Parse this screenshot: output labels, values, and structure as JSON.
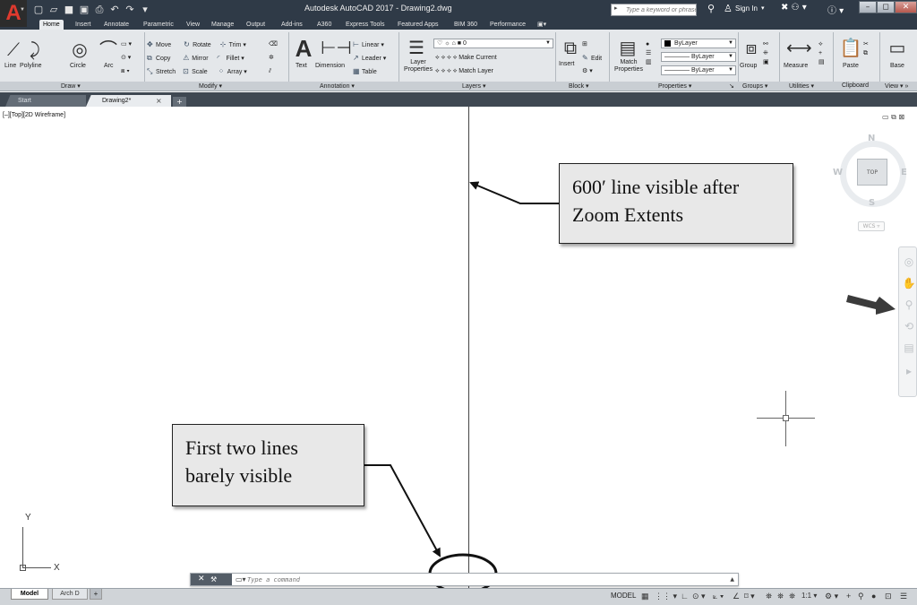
{
  "title_bar": {
    "window_title": "Autodesk AutoCAD 2017 - Drawing2.dwg",
    "app_logo": "A",
    "qat_icons": [
      "new-icon",
      "open-icon",
      "save-icon",
      "saveas-icon",
      "plot-icon",
      "undo-icon",
      "redo-icon",
      "customize-icon"
    ],
    "qat_glyphs": [
      "▢",
      "▱",
      "■",
      "▣",
      "⎙",
      "↶",
      "↷",
      "▾"
    ],
    "search_placeholder": "Type a keyword or phrase",
    "sign_in": "Sign In"
  },
  "ribbon_tabs": [
    "Home",
    "Insert",
    "Annotate",
    "Parametric",
    "View",
    "Manage",
    "Output",
    "Add-ins",
    "A360",
    "Express Tools",
    "Featured Apps",
    "BIM 360",
    "Performance"
  ],
  "ribbon": {
    "draw": {
      "title": "Draw ▾",
      "tools": [
        "Line",
        "Polyline",
        "Circle",
        "Arc"
      ]
    },
    "modify": {
      "title": "Modify ▾",
      "rows": [
        [
          "Move",
          "Rotate",
          "Trim ▾"
        ],
        [
          "Copy",
          "Mirror",
          "Fillet ▾"
        ],
        [
          "Stretch",
          "Scale",
          "Array ▾"
        ]
      ]
    },
    "annotation": {
      "title": "Annotation ▾",
      "big": [
        "Text",
        "Dimension"
      ],
      "small": [
        "Linear ▾",
        "Leader ▾",
        "Table"
      ]
    },
    "layers": {
      "title": "Layers ▾",
      "big": "Layer Properties",
      "current_layer": "0",
      "small": [
        "Make Current",
        "Match Layer"
      ]
    },
    "block": {
      "title": "Block ▾",
      "big": "Insert",
      "small": "Edit"
    },
    "properties": {
      "title": "Properties ▾",
      "big": "Match Properties",
      "color": "ByLayer",
      "linetype": "ByLayer",
      "lineweight": "ByLayer"
    },
    "groups": {
      "title": "Groups ▾",
      "big": "Group"
    },
    "utilities": {
      "title": "Utilities ▾",
      "big": "Measure"
    },
    "clipboard": {
      "title": "Clipboard",
      "big": "Paste"
    },
    "view": {
      "title": "View ▾ »",
      "big": "Base"
    }
  },
  "doc_tabs": {
    "start": "Start",
    "drawing": "Drawing2*",
    "close": "×",
    "new": "+"
  },
  "viewport": {
    "label": "[–][Top][2D Wireframe]",
    "controls": "▭ ⧉ ⊠"
  },
  "viewcube": {
    "n": "N",
    "s": "S",
    "e": "E",
    "w": "W",
    "face": "TOP",
    "wcs": "WCS ▿"
  },
  "ucs": {
    "x": "X",
    "y": "Y"
  },
  "callouts": {
    "zoom": "600′ line visible after Zoom Extents",
    "lines": "First two lines barely visible"
  },
  "command_line": {
    "placeholder": "Type a command",
    "close": "✕",
    "wrench": "🔧",
    "recent": "▭▾"
  },
  "layout_tabs": {
    "model": "Model",
    "arch": "Arch D",
    "add": "+"
  },
  "status_bar": {
    "space": "MODEL",
    "scale": "1:1 ▾"
  },
  "colors": {
    "title_bar": "#2f3a47",
    "ribbon": "#e4e7ea",
    "callout_fill": "#e8e8e8",
    "drawing_line": "#444444"
  }
}
